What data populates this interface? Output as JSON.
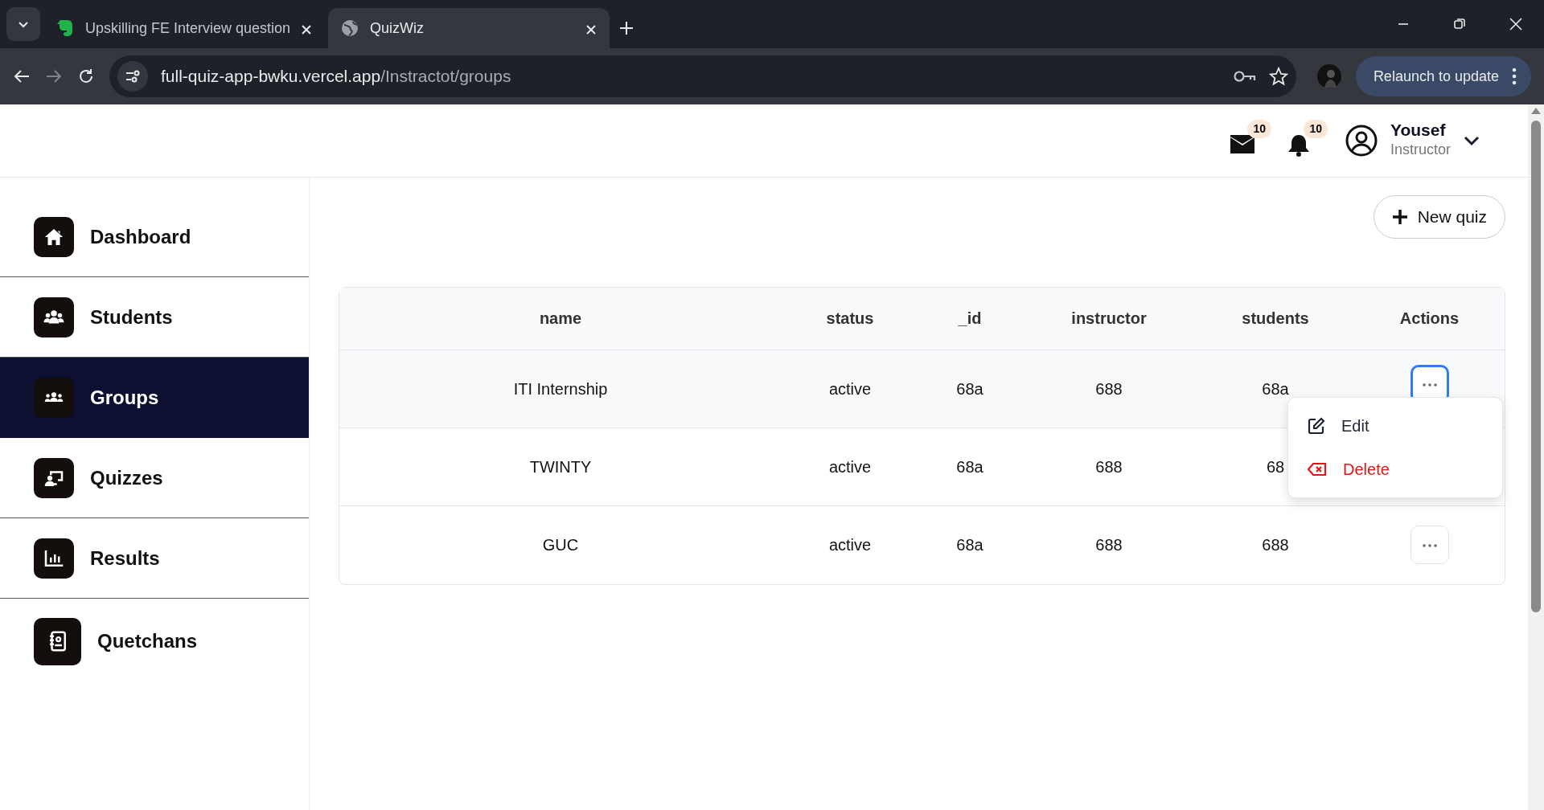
{
  "browser": {
    "tabs": [
      {
        "title": "Upskilling FE Interview question",
        "kind": "evernote",
        "selected": false
      },
      {
        "title": "QuizWiz",
        "kind": "globe",
        "selected": true
      }
    ],
    "url_host": "full-quiz-app-bwku.vercel.app",
    "url_path": "/Instractot/groups",
    "relaunch": "Relaunch to update"
  },
  "header": {
    "mail_count": "10",
    "notification_count": "10",
    "user_name": "Yousef",
    "user_role": "Instructor"
  },
  "sidebar": {
    "items": [
      {
        "label": "Dashboard",
        "kind": "home",
        "selected": false
      },
      {
        "label": "Students",
        "kind": "students",
        "selected": false
      },
      {
        "label": "Groups",
        "kind": "groups",
        "selected": true
      },
      {
        "label": "Quizzes",
        "kind": "quizzes",
        "selected": false
      },
      {
        "label": "Results",
        "kind": "results",
        "selected": false
      },
      {
        "label": "Quetchans",
        "kind": "questions",
        "selected": false
      }
    ]
  },
  "new_quiz_button": "New quiz",
  "table": {
    "columns": [
      "name",
      "status",
      "_id",
      "instructor",
      "students",
      "Actions"
    ],
    "rows": [
      {
        "cells": [
          "ITI Internship",
          "active",
          "68a",
          "688",
          "68a"
        ],
        "menu_open": true
      },
      {
        "cells": [
          "TWINTY",
          "active",
          "68a",
          "688",
          "68"
        ],
        "menu_open": false
      },
      {
        "cells": [
          "GUC",
          "active",
          "68a",
          "688",
          "688"
        ],
        "menu_open": false
      }
    ]
  },
  "row_menu": {
    "items": [
      {
        "label": "Edit",
        "kind": "edit"
      },
      {
        "label": "Delete",
        "kind": "delete"
      }
    ]
  }
}
